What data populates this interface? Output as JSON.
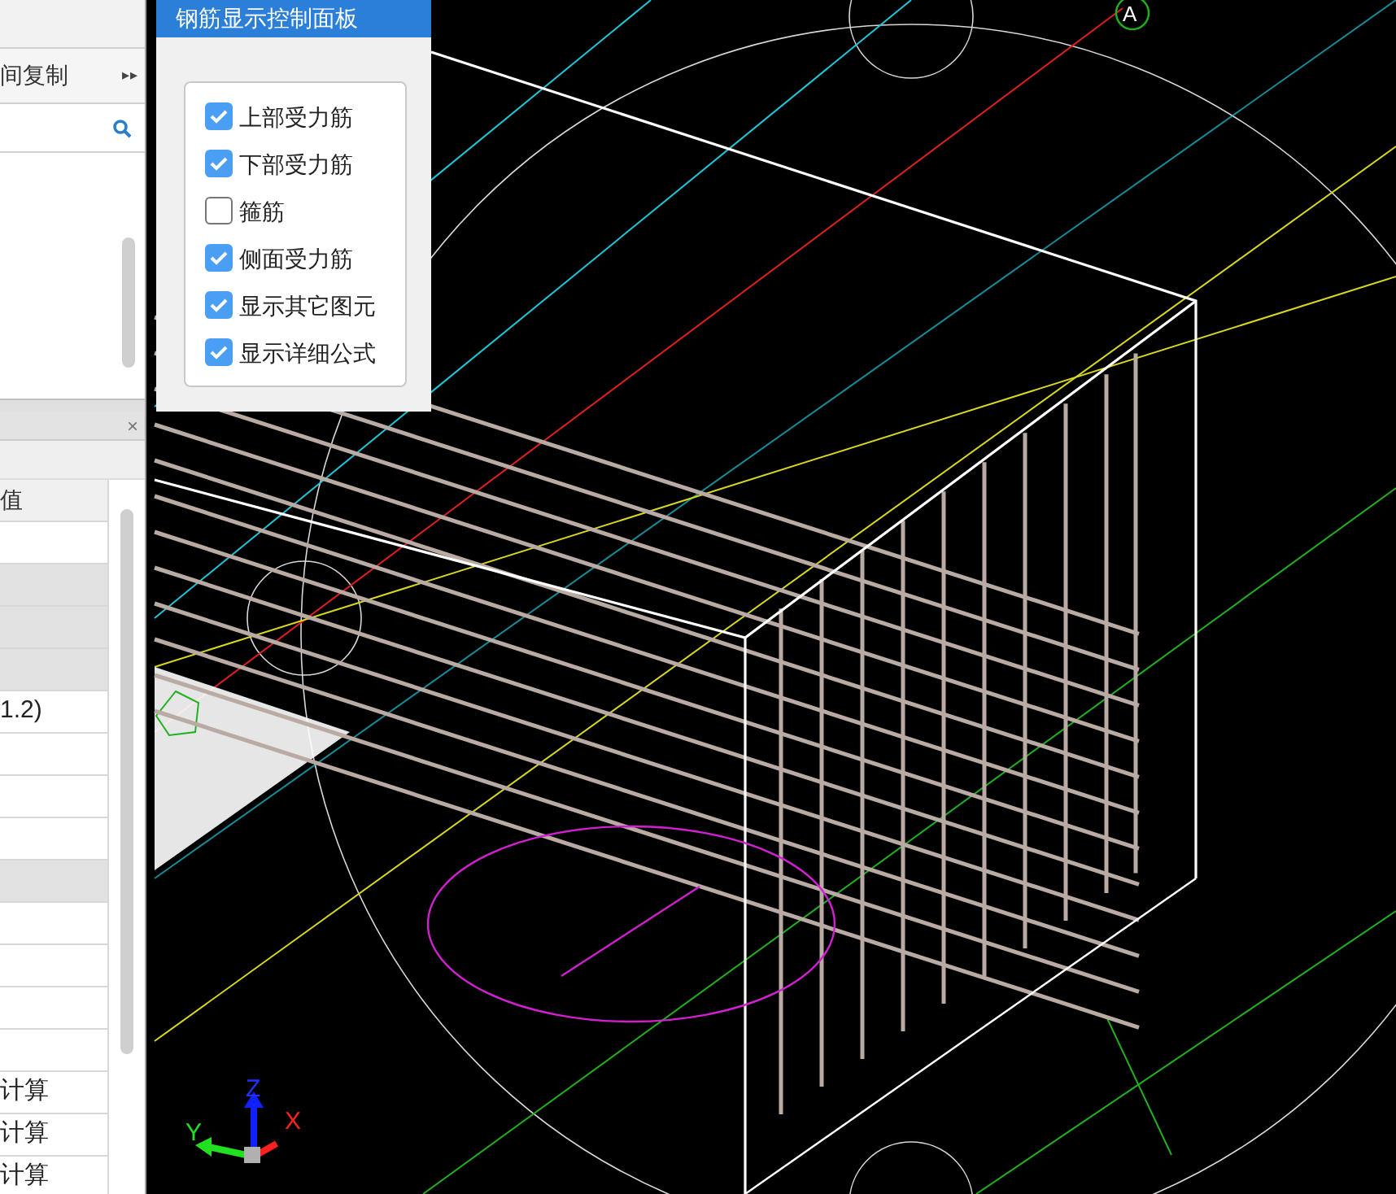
{
  "left_panel": {
    "copy_row": {
      "label": "间复制",
      "expand": "▸▸"
    }
  },
  "property_panel": {
    "header": {
      "close": "×"
    },
    "column_header": "值",
    "rows": [
      {
        "value": "",
        "shaded": false
      },
      {
        "value": "",
        "shaded": true
      },
      {
        "value": "",
        "shaded": true
      },
      {
        "value": "",
        "shaded": true
      },
      {
        "value": "1.2)",
        "shaded": false
      },
      {
        "value": "",
        "shaded": false
      },
      {
        "value": "",
        "shaded": false
      },
      {
        "value": "",
        "shaded": false
      },
      {
        "value": "",
        "shaded": true
      },
      {
        "value": "",
        "shaded": false
      },
      {
        "value": "",
        "shaded": false
      },
      {
        "value": "",
        "shaded": false
      },
      {
        "value": "",
        "shaded": false
      },
      {
        "value": "计算",
        "shaded": false
      },
      {
        "value": "计算",
        "shaded": false
      },
      {
        "value": "计算",
        "shaded": false
      }
    ]
  },
  "control_panel": {
    "title": "钢筋显示控制面板",
    "options": [
      {
        "label": "上部受力筋",
        "checked": true
      },
      {
        "label": "下部受力筋",
        "checked": true
      },
      {
        "label": "箍筋",
        "checked": false
      },
      {
        "label": "侧面受力筋",
        "checked": true
      },
      {
        "label": "显示其它图元",
        "checked": true
      },
      {
        "label": "显示详细公式",
        "checked": true
      }
    ]
  },
  "viewport": {
    "grid_marker": "A",
    "axes": {
      "x": "X",
      "y": "Y",
      "z": "Z"
    }
  }
}
